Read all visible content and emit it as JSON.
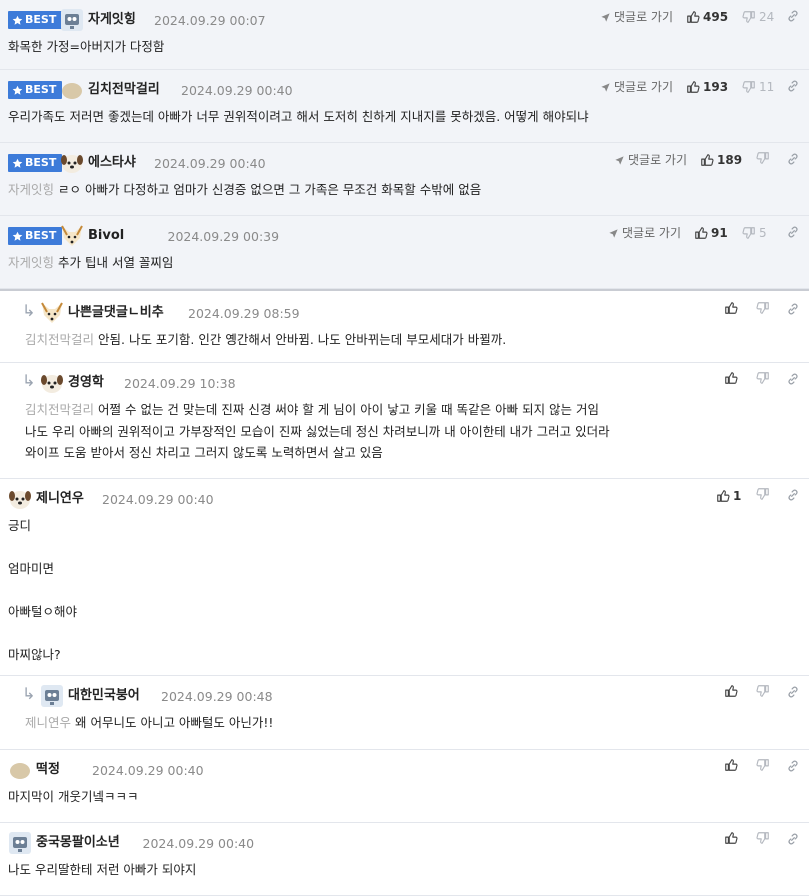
{
  "labels": {
    "best": "BEST",
    "reply_link": "댓글로 가기"
  },
  "colors": {
    "best_badge": "#3d7bd9",
    "best_background": "#f2f4f8",
    "mention": "#a9a9a9"
  },
  "comments": [
    {
      "best": true,
      "avatar": "robot-avatar-icon",
      "nickname": "자게잇힝",
      "date": "2024.09.29 00:07",
      "likes": "495",
      "dislikes": "24",
      "lines": [
        {
          "mention": "",
          "text": "화목한 가정=아버지가 다정함"
        }
      ]
    },
    {
      "best": true,
      "avatar": "dot-avatar-icon",
      "nickname": "김치전막걸리",
      "date": "2024.09.29 00:40",
      "likes": "193",
      "dislikes": "11",
      "lines": [
        {
          "mention": "",
          "text": "우리가족도 저러면 좋겠는데 아빠가 너무 권위적이려고 해서 도저히 친하게 지내지를 못하겠음. 어떻게 해야되냐"
        }
      ]
    },
    {
      "best": true,
      "avatar": "dog-avatar-icon",
      "nickname": "에스타샤",
      "date": "2024.09.29 00:40",
      "likes": "189",
      "dislikes": "",
      "lines": [
        {
          "mention": "자게잇힝",
          "text": "ㄹㅇ 아빠가 다정하고 엄마가 신경증 없으면 그 가족은 무조건 화목할 수밖에 없음"
        }
      ]
    },
    {
      "best": true,
      "avatar": "fox-avatar-icon",
      "nickname": "Bivol",
      "date": "2024.09.29 00:39",
      "likes": "91",
      "dislikes": "5",
      "lines": [
        {
          "mention": "자게잇힝",
          "text": "추가 팁내 서열 꼴찌임"
        }
      ]
    },
    {
      "best": false,
      "reply": true,
      "avatar": "fox-avatar-icon",
      "nickname": "나쁜글댓글ㄴ비추",
      "date": "2024.09.29 08:59",
      "likes": "",
      "dislikes": "",
      "lines": [
        {
          "mention": "김치전막걸리",
          "text": "안됨. 나도 포기함. 인간 옝간해서 안바뀜. 나도 안바뀌는데 부모세대가 바뀔까."
        }
      ]
    },
    {
      "best": false,
      "reply": true,
      "avatar": "dog-avatar-icon",
      "nickname": "경영학",
      "date": "2024.09.29 10:38",
      "likes": "",
      "dislikes": "",
      "lines": [
        {
          "mention": "김치전막걸리",
          "text": "어쩔 수 없는 건 맞는데 진짜 신경 써야 할 게 님이 아이 낳고 키울 때 똑같은 아빠 되지 않는 거임"
        },
        {
          "mention": "",
          "text": "나도 우리 아빠의 권위적이고 가부장적인 모습이 진짜 싫었는데 정신 차려보니까 내 아이한테 내가 그러고 있더라"
        },
        {
          "mention": "",
          "text": "와이프 도움 받아서 정신 차리고 그러지 않도록 노력하면서 살고 있음"
        }
      ]
    },
    {
      "best": false,
      "reply": false,
      "avatar": "dog-avatar-icon",
      "nickname": "제니연우",
      "date": "2024.09.29 00:40",
      "likes": "1",
      "dislikes": "",
      "lines": [
        {
          "mention": "",
          "text": "긍디"
        },
        {
          "mention": "",
          "text": ""
        },
        {
          "mention": "",
          "text": "엄마미면"
        },
        {
          "mention": "",
          "text": ""
        },
        {
          "mention": "",
          "text": "아빠털ㅇ해야"
        },
        {
          "mention": "",
          "text": ""
        },
        {
          "mention": "",
          "text": "마찌않나?"
        }
      ]
    },
    {
      "best": false,
      "reply": true,
      "avatar": "robot-avatar-icon",
      "nickname": "대한민국붕어",
      "date": "2024.09.29 00:48",
      "likes": "",
      "dislikes": "",
      "lines": [
        {
          "mention": "제니연우",
          "text": "왜 어무니도 아니고 아빠털도 아닌가!!"
        }
      ]
    },
    {
      "best": false,
      "reply": false,
      "avatar": "dot-avatar-icon",
      "nickname": "떡정",
      "date": "2024.09.29 00:40",
      "likes": "",
      "dislikes": "",
      "lines": [
        {
          "mention": "",
          "text": "마지막이 개웃기넼ㅋㅋㅋ"
        }
      ]
    },
    {
      "best": false,
      "reply": false,
      "avatar": "robot-avatar-icon",
      "nickname": "중국몽팔이소년",
      "date": "2024.09.29 00:40",
      "likes": "",
      "dislikes": "",
      "lines": [
        {
          "mention": "",
          "text": "나도 우리딸한테 저런 아빠가 되야지"
        }
      ]
    }
  ]
}
